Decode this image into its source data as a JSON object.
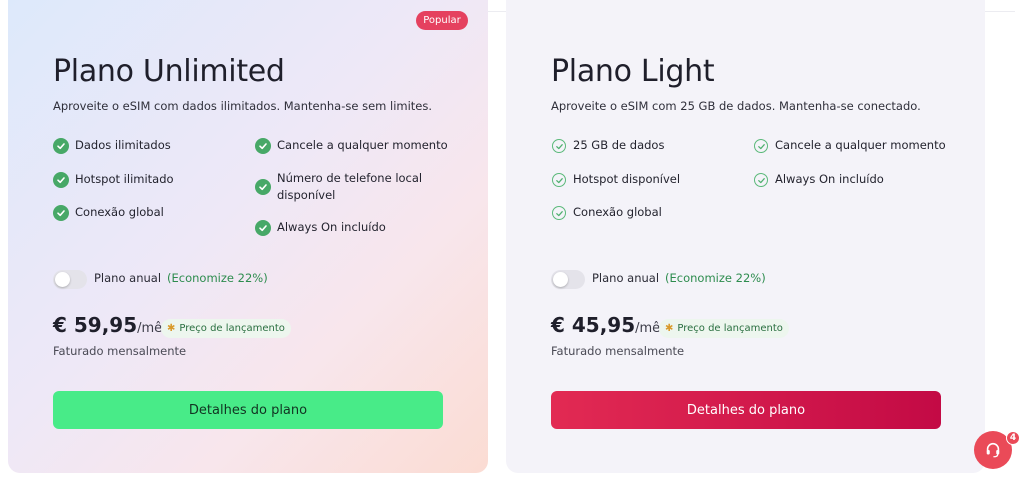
{
  "plans": [
    {
      "badge": "Popular",
      "title": "Plano Unlimited",
      "description": "Aproveite o eSIM com dados ilimitados. Mantenha-se sem limites.",
      "features_left": [
        "Dados ilimitados",
        "Hotspot ilimitado",
        "Conexão global"
      ],
      "features_right": [
        "Cancele a qualquer momento",
        "Número de telefone local disponível",
        "Always On incluído"
      ],
      "annual_label": "Plano anual",
      "annual_savings": "(Economize 22%)",
      "annual_enabled": false,
      "price": "€ 59,95",
      "period": "/mês",
      "promo_pill": "Preço de lançamento",
      "billed": "Faturado mensalmente",
      "button": "Detalhes do plano",
      "button_color": "#48eb88"
    },
    {
      "title": "Plano Light",
      "description": "Aproveite o eSIM com 25 GB de dados. Mantenha-se conectado.",
      "features_left": [
        "25 GB de dados",
        "Hotspot disponível",
        "Conexão global"
      ],
      "features_right": [
        "Cancele a qualquer momento",
        "Always On incluído"
      ],
      "annual_label": "Plano anual",
      "annual_savings": "(Economize 22%)",
      "annual_enabled": false,
      "price": "€ 45,95",
      "period": "/mês",
      "promo_pill": "Preço de lançamento",
      "billed": "Faturado mensalmente",
      "button": "Detalhes do plano",
      "button_color": "#d61a4c"
    }
  ],
  "chat": {
    "icon": "headset-icon",
    "unread_count": "4",
    "color": "#ea4a58"
  },
  "colors": {
    "check_green": "#47a867",
    "badge_red": "#e5415f",
    "savings_green": "#2d8c4e"
  }
}
